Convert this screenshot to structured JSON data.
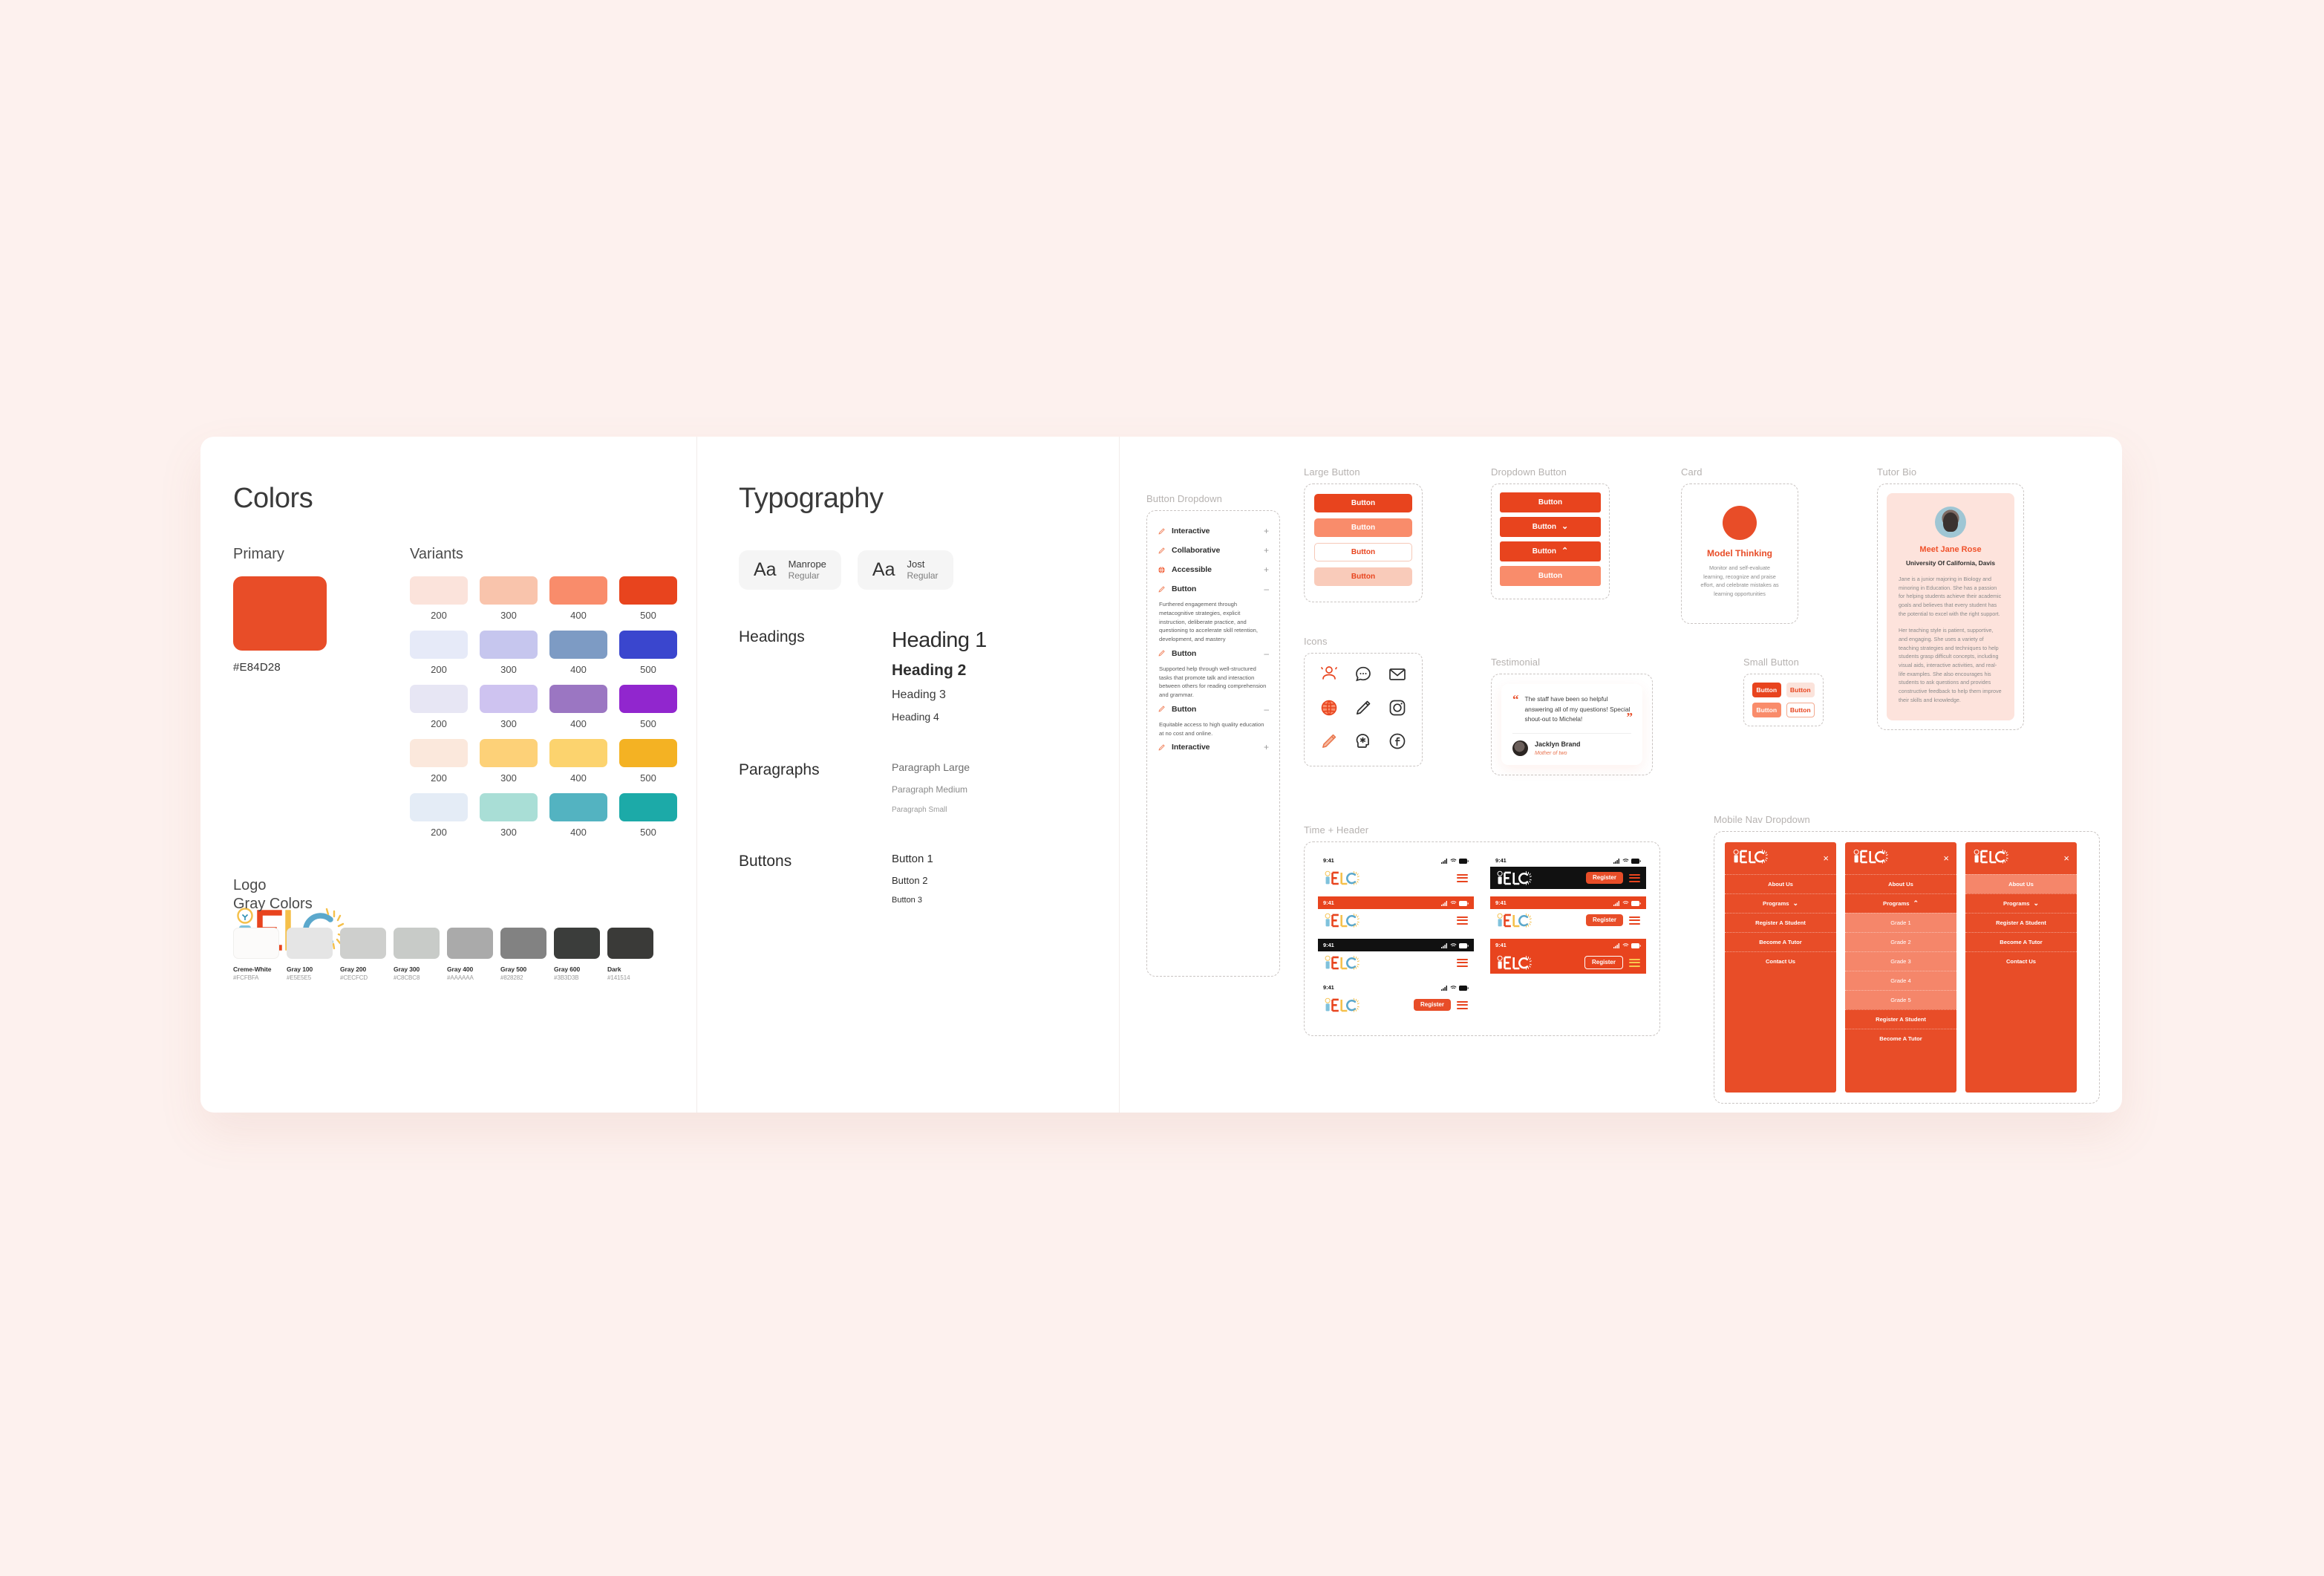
{
  "colors": {
    "section_title": "Colors",
    "primary": {
      "label": "Primary",
      "hex": "#E84D28",
      "swatch": "#E84D28"
    },
    "variants": {
      "label": "Variants",
      "steps": [
        "200",
        "300",
        "400",
        "500"
      ],
      "rows": [
        {
          "name": "orange",
          "colors": [
            "#FBE3DB",
            "#F9C4AC",
            "#F98C6B",
            "#E8441E"
          ]
        },
        {
          "name": "blue",
          "colors": [
            "#E6EAF8",
            "#C6C6EE",
            "#7D9BC4",
            "#3A46CE"
          ]
        },
        {
          "name": "purple",
          "colors": [
            "#E7E6F4",
            "#CEC3F0",
            "#9B76C2",
            "#9126CE"
          ]
        },
        {
          "name": "yellow",
          "colors": [
            "#FBE8DC",
            "#FDD178",
            "#FCD36E",
            "#F4B223"
          ]
        },
        {
          "name": "teal",
          "colors": [
            "#E4ECF6",
            "#A9DED6",
            "#53B3C1",
            "#1CAAA8"
          ]
        }
      ]
    },
    "logo": {
      "label": "Logo",
      "wordmark": "iELC"
    },
    "gray": {
      "label": "Gray Colors",
      "swatches": [
        {
          "name": "Creme-White",
          "hex": "#FCFBFA",
          "color": "#FCFBFA"
        },
        {
          "name": "Gray 100",
          "hex": "#E5E5E5",
          "color": "#E5E5E5"
        },
        {
          "name": "Gray 200",
          "hex": "#CECFCD",
          "color": "#CECFCD"
        },
        {
          "name": "Gray 300",
          "hex": "#C8CBC8",
          "color": "#C8CBC8"
        },
        {
          "name": "Gray 400",
          "hex": "#AAAAAA",
          "color": "#AAAAAA"
        },
        {
          "name": "Gray 500",
          "hex": "#828282",
          "color": "#828282"
        },
        {
          "name": "Gray 600",
          "hex": "#3B3D3B",
          "color": "#3B3D3B"
        },
        {
          "name": "Dark",
          "hex": "#141514",
          "color": "#3A3A38"
        }
      ]
    }
  },
  "typography": {
    "section_title": "Typography",
    "fonts": [
      {
        "sample": "Aa",
        "family": "Manrope",
        "weight": "Regular"
      },
      {
        "sample": "Aa",
        "family": "Jost",
        "weight": "Regular"
      }
    ],
    "headings": {
      "label": "Headings",
      "samples": [
        "Heading 1",
        "Heading 2",
        "Heading 3",
        "Heading 4"
      ]
    },
    "paragraphs": {
      "label": "Paragraphs",
      "samples": [
        "Paragraph Large",
        "Paragraph Medium",
        "Paragraph Small"
      ]
    },
    "buttons": {
      "label": "Buttons",
      "samples": [
        "Button 1",
        "Button 2",
        "Button 3"
      ]
    }
  },
  "components": {
    "button_dropdown": {
      "caption": "Button Dropdown",
      "items": [
        {
          "label": "Interactive",
          "state": "+",
          "icon": "pencil-icon",
          "body": ""
        },
        {
          "label": "Collaborative",
          "state": "+",
          "icon": "pencil-icon",
          "body": ""
        },
        {
          "label": "Accessible",
          "state": "+",
          "icon": "globe-icon",
          "body": ""
        },
        {
          "label": "Button",
          "state": "–",
          "icon": "pencil-icon",
          "body": "Furthered engagement through metacognitive strategies, explicit instruction, deliberate practice, and questioning to accelerate skill retention, development, and mastery"
        },
        {
          "label": "Button",
          "state": "–",
          "icon": "pencil-icon",
          "body": "Supported help through well-structured tasks that promote talk and interaction between others for reading comprehension and grammar."
        },
        {
          "label": "Button",
          "state": "–",
          "icon": "pencil-icon",
          "body": "Equitable access to high quality education at no cost and online."
        },
        {
          "label": "Interactive",
          "state": "+",
          "icon": "pencil-icon",
          "body": ""
        }
      ]
    },
    "large_button": {
      "caption": "Large Button",
      "buttons": [
        {
          "label": "Button",
          "bg": "#E8441E",
          "fg": "#ffffff",
          "border": "none"
        },
        {
          "label": "Button",
          "bg": "#F98C6B",
          "fg": "#ffffff",
          "border": "none"
        },
        {
          "label": "Button",
          "bg": "#ffffff",
          "fg": "#E8441E",
          "border": "1px solid #F6C9B8"
        },
        {
          "label": "Button",
          "bg": "#F9CBBA",
          "fg": "#E8441E",
          "border": "none"
        }
      ]
    },
    "dropdown_button": {
      "caption": "Dropdown Button",
      "buttons": [
        {
          "label": "Button",
          "chevron": "",
          "bg": "#E8441E"
        },
        {
          "label": "Button",
          "chevron": "⌄",
          "bg": "#E8441E"
        },
        {
          "label": "Button",
          "chevron": "⌃",
          "bg": "#E8441E"
        },
        {
          "label": "Button",
          "chevron": "",
          "bg": "#F98C6B"
        }
      ]
    },
    "card": {
      "caption": "Card",
      "title": "Model Thinking",
      "body": "Monitor and self-evaluate learning, recognize and praise effort, and celebrate mistakes as learning opportunities"
    },
    "tutor_bio": {
      "caption": "Tutor Bio",
      "name": "Meet Jane Rose",
      "university": "University Of California, Davis",
      "paragraph1": "Jane is a junior majoring in Biology and minoring in Education. She has a passion for helping students achieve their academic goals and believes that every student has the potential to excel with the right support.",
      "paragraph2": "Her teaching style is patient, supportive, and engaging. She uses a variety of teaching strategies and techniques to help students grasp difficult concepts, including visual aids, interactive activities, and real-life examples. She also encourages his students to ask questions and provides constructive feedback to help them improve their skills and knowledge."
    },
    "icons": {
      "caption": "Icons",
      "items": [
        {
          "name": "people-icon",
          "color": "#E8441E"
        },
        {
          "name": "chat-icon",
          "color": "#2e2e2e"
        },
        {
          "name": "mail-icon",
          "color": "#2e2e2e"
        },
        {
          "name": "globe-icon",
          "color": "#E8441E"
        },
        {
          "name": "pencil-icon",
          "color": "#2e2e2e"
        },
        {
          "name": "instagram-icon",
          "color": "#2e2e2e"
        },
        {
          "name": "pencil-filled-icon",
          "color": "#F09070"
        },
        {
          "name": "head-idea-icon",
          "color": "#2e2e2e"
        },
        {
          "name": "facebook-icon",
          "color": "#2e2e2e"
        }
      ]
    },
    "testimonial": {
      "caption": "Testimonial",
      "quote": "The staff have been so helpful answering all of my questions! Special shout-out to Michela!",
      "author": "Jacklyn Brand",
      "role": "Mother of two",
      "open_quote": "“",
      "close_quote": "”"
    },
    "small_button": {
      "caption": "Small Button",
      "buttons": [
        {
          "label": "Button",
          "bg": "#E8441E",
          "fg": "#ffffff",
          "border": "none"
        },
        {
          "label": "Button",
          "bg": "#FBE3DB",
          "fg": "#E8441E",
          "border": "none"
        },
        {
          "label": "Button",
          "bg": "#F98C6B",
          "fg": "#ffffff",
          "border": "none"
        },
        {
          "label": "Button",
          "bg": "#ffffff",
          "fg": "#E8441E",
          "border": "1px solid #F2A98F"
        }
      ]
    },
    "time_header": {
      "caption": "Time + Header",
      "time": "9:41",
      "register_label": "Register",
      "logo": "iELC",
      "rows": [
        {
          "status_bg": "#ffffff",
          "status_fg": "#111111",
          "header_bg": "#ffffff",
          "has_register": false
        },
        {
          "status_bg": "#E8441E",
          "status_fg": "#ffffff",
          "header_bg": "#ffffff",
          "has_register": false
        },
        {
          "status_bg": "#111111",
          "status_fg": "#ffffff",
          "header_bg": "#ffffff",
          "has_register": false
        },
        {
          "status_bg": "#ffffff",
          "status_fg": "#111111",
          "header_bg": "#ffffff",
          "has_register": true
        },
        {
          "status_bg": "#ffffff",
          "status_fg": "#111111",
          "header_bg": "#111111",
          "has_register": true
        },
        {
          "status_bg": "#E8441E",
          "status_fg": "#ffffff",
          "header_bg": "#ffffff",
          "has_register": true
        },
        {
          "status_bg": "#E8441E",
          "status_fg": "#ffffff",
          "header_bg": "#E8441E",
          "has_register": true
        }
      ]
    },
    "mobile_nav": {
      "caption": "Mobile Nav Dropdown",
      "logo": "iELC",
      "close_icon": "×",
      "menus": [
        {
          "state": "collapsed",
          "items": [
            {
              "label": "About Us",
              "type": "item"
            },
            {
              "label": "Programs",
              "type": "item",
              "chevron": "⌄"
            },
            {
              "label": "Register A Student",
              "type": "item"
            },
            {
              "label": "Become A Tutor",
              "type": "item"
            },
            {
              "label": "Contact Us",
              "type": "item"
            }
          ]
        },
        {
          "state": "expanded",
          "items": [
            {
              "label": "About Us",
              "type": "item"
            },
            {
              "label": "Programs",
              "type": "item",
              "chevron": "⌃"
            },
            {
              "label": "Grade 1",
              "type": "sub"
            },
            {
              "label": "Grade 2",
              "type": "sub"
            },
            {
              "label": "Grade 3",
              "type": "sub"
            },
            {
              "label": "Grade 4",
              "type": "sub"
            },
            {
              "label": "Grade 5",
              "type": "sub"
            },
            {
              "label": "Register A Student",
              "type": "item"
            },
            {
              "label": "Become A Tutor",
              "type": "item"
            }
          ]
        },
        {
          "state": "hover",
          "items": [
            {
              "label": "About Us",
              "type": "highlight"
            },
            {
              "label": "Programs",
              "type": "item",
              "chevron": "⌄"
            },
            {
              "label": "Register A Student",
              "type": "item"
            },
            {
              "label": "Become A Tutor",
              "type": "item"
            },
            {
              "label": "Contact Us",
              "type": "item"
            }
          ]
        }
      ]
    }
  }
}
